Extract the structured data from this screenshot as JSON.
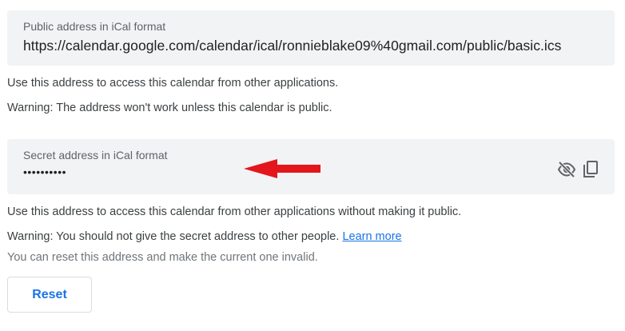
{
  "public_section": {
    "label": "Public address in iCal format",
    "url": "https://calendar.google.com/calendar/ical/ronnieblake09%40gmail.com/public/basic.ics",
    "info_text": "Use this address to access this calendar from other applications.",
    "warning_text": "Warning: The address won't work unless this calendar is public."
  },
  "secret_section": {
    "label": "Secret address in iCal format",
    "masked_value": "••••••••••",
    "annotation_arrow_color": "#e3161b",
    "info_text": "Use this address to access this calendar from other applications without making it public.",
    "warning_text": "Warning: You should not give the secret address to other people.",
    "learn_more_label": "Learn more",
    "reset_info_text": "You can reset this address and make the current one invalid.",
    "reset_button_label": "Reset",
    "icons": [
      "visibility-off-icon",
      "copy-icon"
    ]
  },
  "colors": {
    "field_background": "#f1f3f4",
    "link_blue": "#1a73e8",
    "text": "#3c4043",
    "muted_text": "#70757a"
  }
}
